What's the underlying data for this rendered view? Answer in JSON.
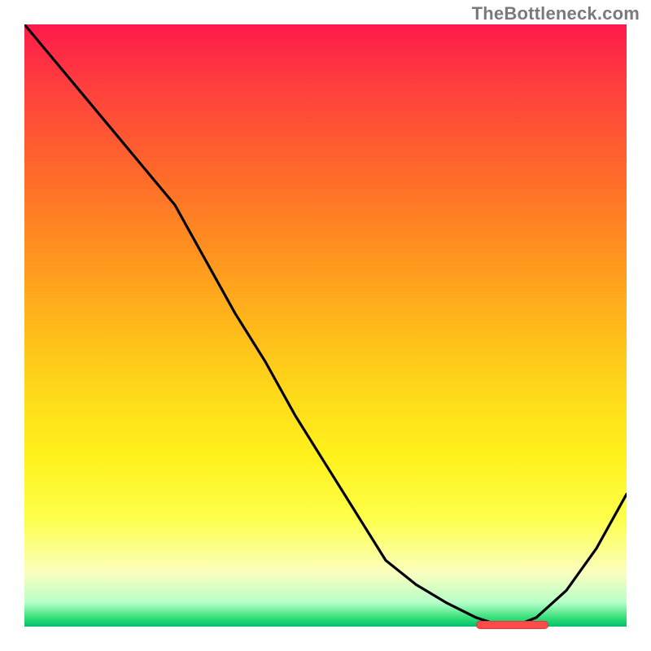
{
  "attribution": "TheBottleneck.com",
  "chart_data": {
    "type": "line",
    "title": "",
    "xlabel": "",
    "ylabel": "",
    "xlim": [
      0,
      100
    ],
    "ylim": [
      0,
      100
    ],
    "series": [
      {
        "name": "curve",
        "x": [
          0,
          5,
          10,
          15,
          20,
          25,
          30,
          35,
          40,
          45,
          50,
          55,
          60,
          65,
          70,
          75,
          78,
          80,
          82,
          85,
          90,
          95,
          100
        ],
        "values": [
          100,
          94,
          88,
          82,
          76,
          70,
          61,
          52,
          44,
          35,
          27,
          19,
          11,
          7,
          4,
          1.5,
          0.5,
          0.3,
          0.3,
          1.5,
          6,
          13,
          22
        ]
      }
    ],
    "background_gradient": {
      "top": "#ff1a4b",
      "mid_upper": "#ffb91a",
      "mid_lower": "#feff4a",
      "bottom": "#00c06a"
    },
    "minimum_marker": {
      "x_start": 75,
      "x_end": 87,
      "y": 0.3
    }
  }
}
